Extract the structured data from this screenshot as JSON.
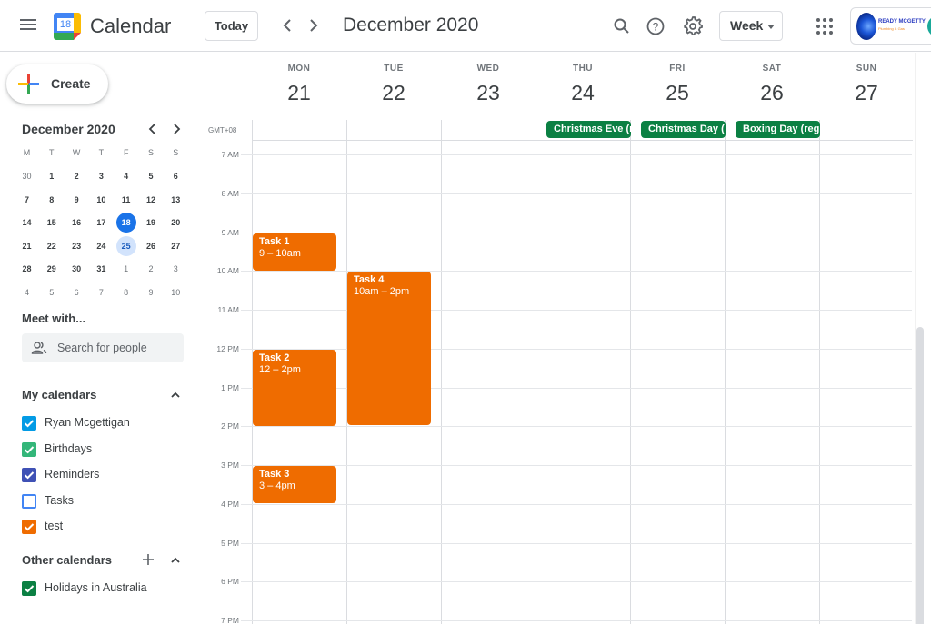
{
  "header": {
    "menu_icon": "hamburger-menu-icon",
    "app_title": "Calendar",
    "logo_day": "18",
    "today_label": "Today",
    "prev_icon": "chevron-left-icon",
    "next_icon": "chevron-right-icon",
    "period_title": "December 2020",
    "search_icon": "search-icon",
    "help_icon": "help-icon",
    "settings_icon": "gear-icon",
    "view_selected": "Week",
    "apps_icon": "apps-grid-icon",
    "account": {
      "org_name": "READY MCGETTY",
      "org_sub": "Plumbing & Gas"
    }
  },
  "sidebar": {
    "create_label": "Create",
    "mini_calendar": {
      "title": "December 2020",
      "dow": [
        "M",
        "T",
        "W",
        "T",
        "F",
        "S",
        "S"
      ],
      "weeks": [
        [
          {
            "d": "30",
            "o": true
          },
          {
            "d": "1"
          },
          {
            "d": "2"
          },
          {
            "d": "3"
          },
          {
            "d": "4"
          },
          {
            "d": "5"
          },
          {
            "d": "6"
          }
        ],
        [
          {
            "d": "7"
          },
          {
            "d": "8"
          },
          {
            "d": "9"
          },
          {
            "d": "10"
          },
          {
            "d": "11"
          },
          {
            "d": "12"
          },
          {
            "d": "13"
          }
        ],
        [
          {
            "d": "14"
          },
          {
            "d": "15"
          },
          {
            "d": "16"
          },
          {
            "d": "17"
          },
          {
            "d": "18",
            "today": true
          },
          {
            "d": "19"
          },
          {
            "d": "20"
          }
        ],
        [
          {
            "d": "21"
          },
          {
            "d": "22"
          },
          {
            "d": "23"
          },
          {
            "d": "24"
          },
          {
            "d": "25",
            "selected": true
          },
          {
            "d": "26"
          },
          {
            "d": "27"
          }
        ],
        [
          {
            "d": "28"
          },
          {
            "d": "29"
          },
          {
            "d": "30"
          },
          {
            "d": "31"
          },
          {
            "d": "1",
            "o": true
          },
          {
            "d": "2",
            "o": true
          },
          {
            "d": "3",
            "o": true
          }
        ],
        [
          {
            "d": "4",
            "o": true
          },
          {
            "d": "5",
            "o": true
          },
          {
            "d": "6",
            "o": true
          },
          {
            "d": "7",
            "o": true
          },
          {
            "d": "8",
            "o": true
          },
          {
            "d": "9",
            "o": true
          },
          {
            "d": "10",
            "o": true
          }
        ]
      ]
    },
    "meet_with": {
      "title": "Meet with...",
      "search_placeholder": "Search for people"
    },
    "my_calendars": {
      "title": "My calendars",
      "items": [
        {
          "label": "Ryan Mcgettigan",
          "color": "#039be5",
          "checked": true
        },
        {
          "label": "Birthdays",
          "color": "#33b679",
          "checked": true
        },
        {
          "label": "Reminders",
          "color": "#3f51b5",
          "checked": true
        },
        {
          "label": "Tasks",
          "color": "#4285f4",
          "checked": false
        },
        {
          "label": "test",
          "color": "#ef6c00",
          "checked": true
        }
      ]
    },
    "other_calendars": {
      "title": "Other calendars",
      "items": [
        {
          "label": "Holidays in Australia",
          "color": "#0b8043",
          "checked": true
        }
      ]
    }
  },
  "week": {
    "timezone": "GMT+08",
    "days": [
      {
        "dow": "MON",
        "num": "21"
      },
      {
        "dow": "TUE",
        "num": "22"
      },
      {
        "dow": "WED",
        "num": "23"
      },
      {
        "dow": "THU",
        "num": "24"
      },
      {
        "dow": "FRI",
        "num": "25"
      },
      {
        "dow": "SAT",
        "num": "26"
      },
      {
        "dow": "SUN",
        "num": "27"
      }
    ],
    "hours": [
      "7 AM",
      "8 AM",
      "9 AM",
      "10 AM",
      "11 AM",
      "12 PM",
      "1 PM",
      "2 PM",
      "3 PM",
      "4 PM",
      "5 PM",
      "6 PM",
      "7 PM"
    ],
    "first_hour": 7,
    "all_day_events": [
      {
        "title": "Christmas Eve (r",
        "day": 3,
        "color": "#0b8043"
      },
      {
        "title": "Christmas Day (",
        "day": 4,
        "color": "#0b8043"
      },
      {
        "title": "Boxing Day (regi",
        "day": 5,
        "color": "#0b8043"
      }
    ],
    "events": [
      {
        "title": "Task 1",
        "time": "9 – 10am",
        "day": 0,
        "start": 9,
        "end": 10,
        "color": "#ef6c00"
      },
      {
        "title": "Task 4",
        "time": "10am – 2pm",
        "day": 1,
        "start": 10,
        "end": 14,
        "color": "#ef6c00"
      },
      {
        "title": "Task 2",
        "time": "12 – 2pm",
        "day": 0,
        "start": 12,
        "end": 14,
        "color": "#ef6c00"
      },
      {
        "title": "Task 3",
        "time": "3 – 4pm",
        "day": 0,
        "start": 15,
        "end": 16,
        "color": "#ef6c00"
      }
    ]
  }
}
